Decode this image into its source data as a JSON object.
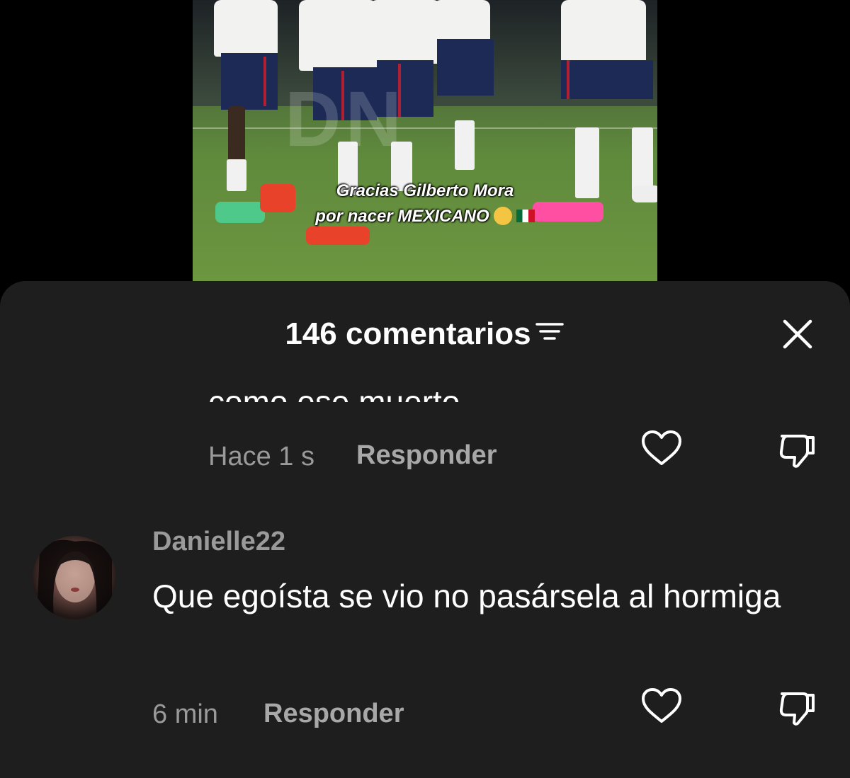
{
  "video": {
    "caption_line1": "Gracias Gilberto Mora",
    "caption_line2": "por nacer MEXICANO",
    "watermark": "DN",
    "emoji": "pleading-face-icon",
    "flag": "mexico-flag-icon"
  },
  "sheet": {
    "title": "146 comentarios",
    "sort_icon": "filter-lines-icon",
    "close_icon": "close-icon"
  },
  "comments": [
    {
      "text": "como ese muerto",
      "time": "Hace 1 s",
      "reply_label": "Responder",
      "like_icon": "heart-outline-icon",
      "dislike_icon": "thumbs-down-icon"
    },
    {
      "username": "Danielle22",
      "text": "Que egoísta se vio no pasársela al hormiga",
      "time": "6 min",
      "reply_label": "Responder",
      "like_icon": "heart-outline-icon",
      "dislike_icon": "thumbs-down-icon"
    }
  ],
  "colors": {
    "sheet_bg": "#1e1e1e",
    "muted_text": "#9a9a9a",
    "primary_text": "#ffffff"
  }
}
